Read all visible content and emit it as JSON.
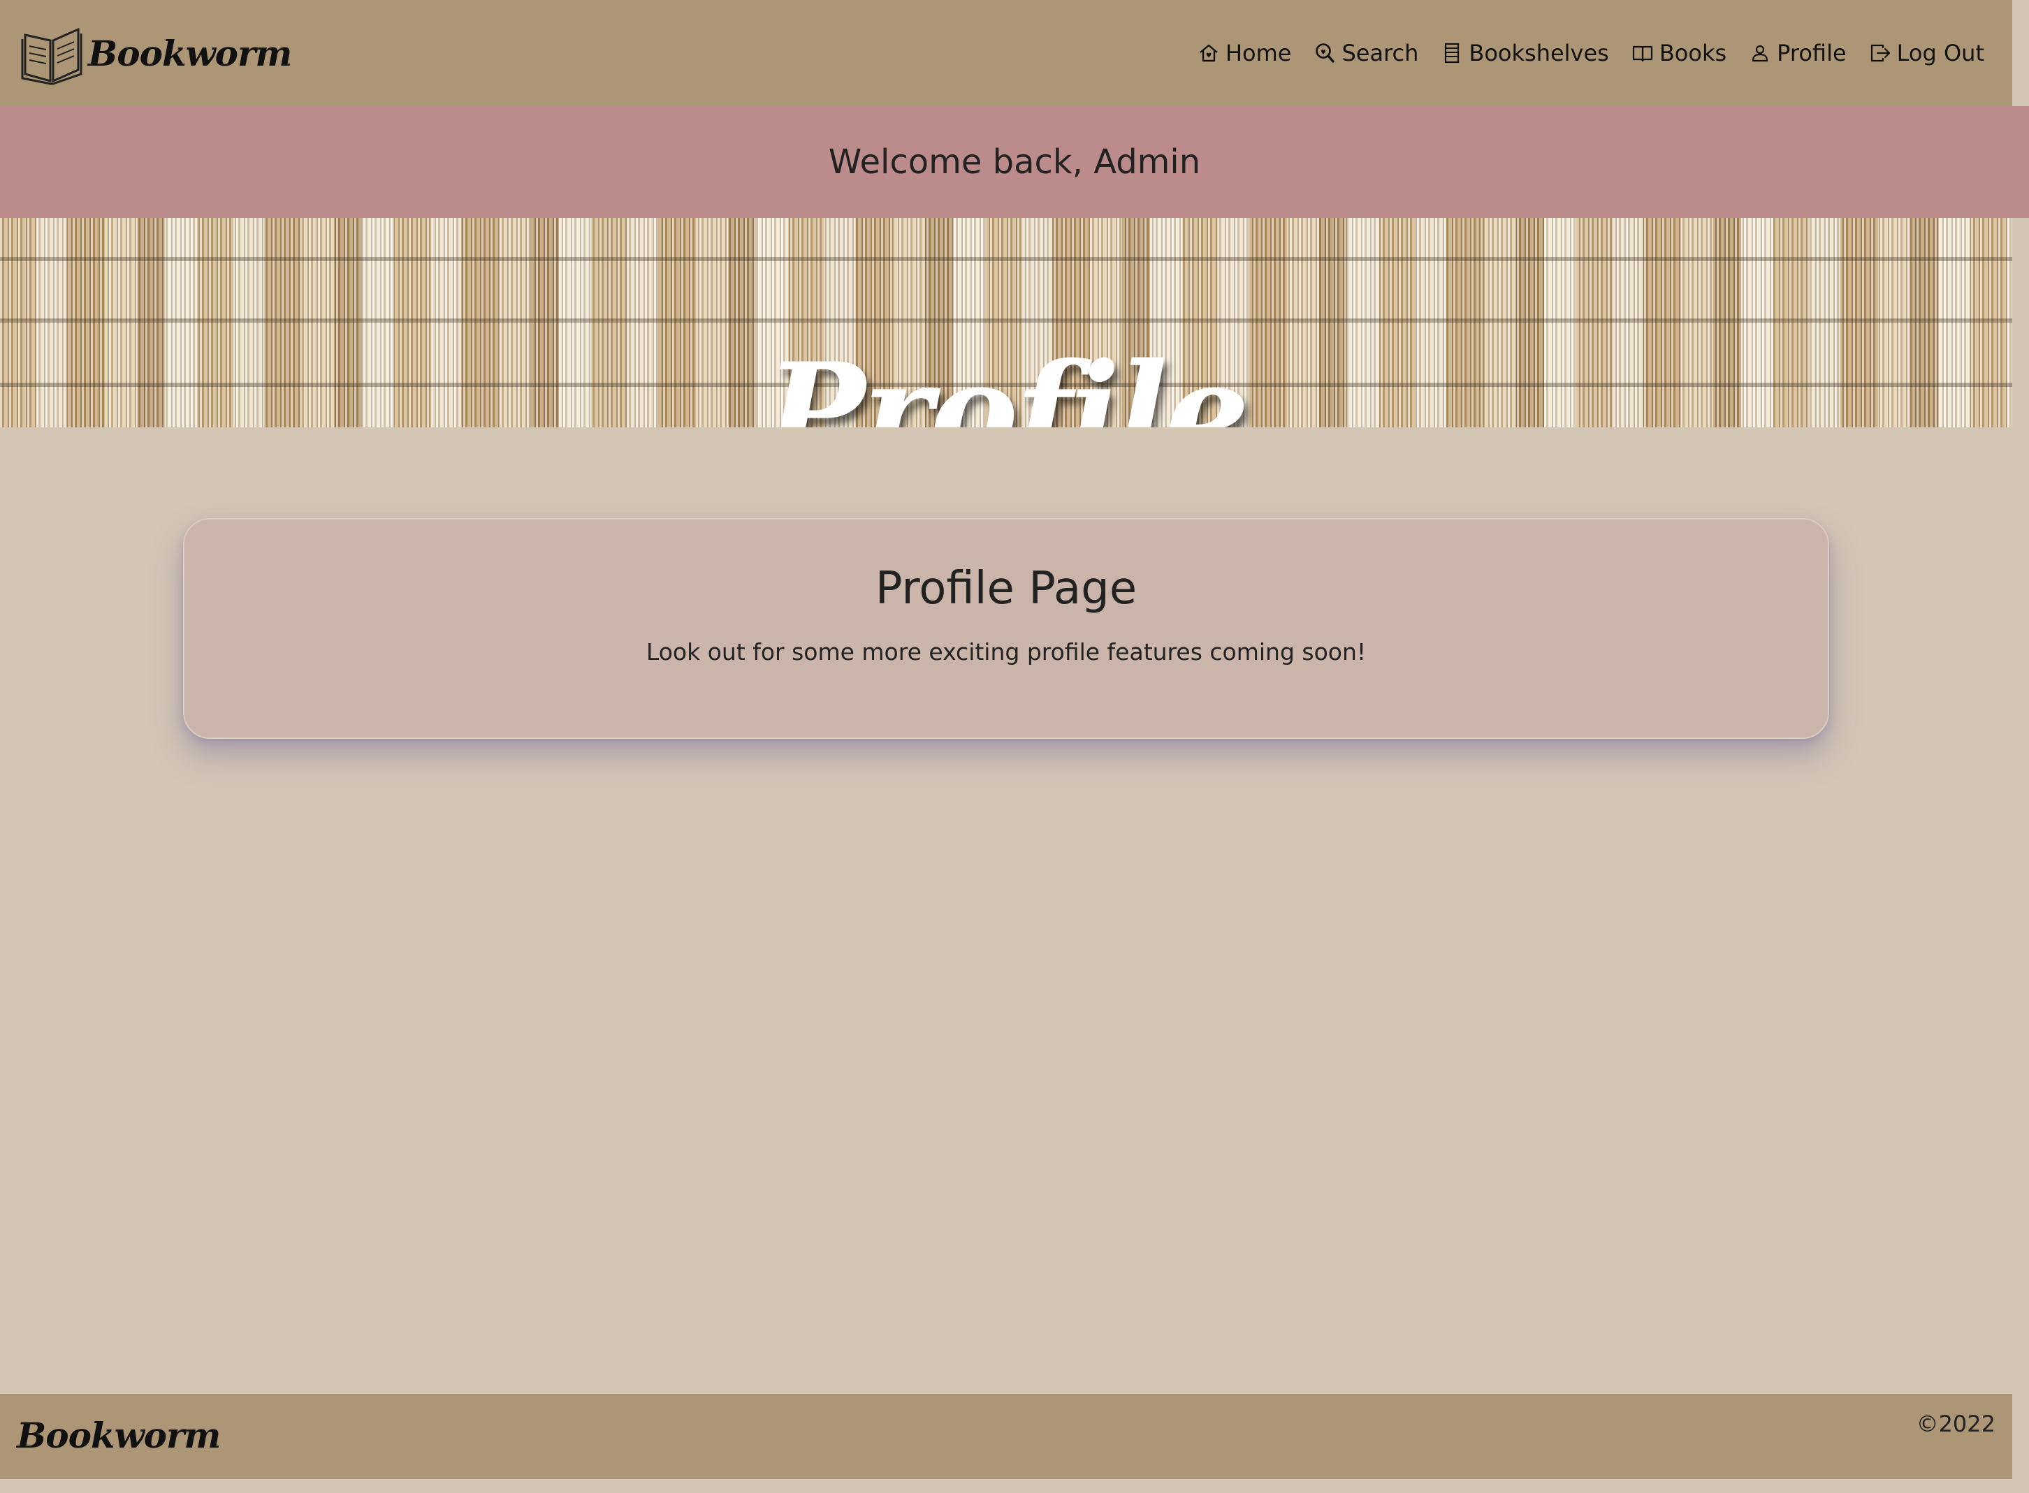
{
  "app": {
    "brand": "Bookworm",
    "brand_icon": "open-book-icon"
  },
  "nav": {
    "items": [
      {
        "label": "Home",
        "icon": "home-icon"
      },
      {
        "label": "Search",
        "icon": "search-icon"
      },
      {
        "label": "Bookshelves",
        "icon": "bookshelf-icon"
      },
      {
        "label": "Books",
        "icon": "book-icon"
      },
      {
        "label": "Profile",
        "icon": "user-icon"
      },
      {
        "label": "Log Out",
        "icon": "logout-icon"
      }
    ]
  },
  "welcome": {
    "text": "Welcome back, Admin"
  },
  "hero": {
    "title": "Profile"
  },
  "card": {
    "title": "Profile Page",
    "text": "Look out for some more exciting profile features coming soon!"
  },
  "footer": {
    "brand": "Bookworm",
    "copyright": "©2022"
  },
  "colors": {
    "navbar": "#ad9675",
    "welcome_banner": "#bc8c8d",
    "page_background": "#d4c6b5",
    "card_background": "#cbb5aa",
    "footer": "#ad9675"
  }
}
